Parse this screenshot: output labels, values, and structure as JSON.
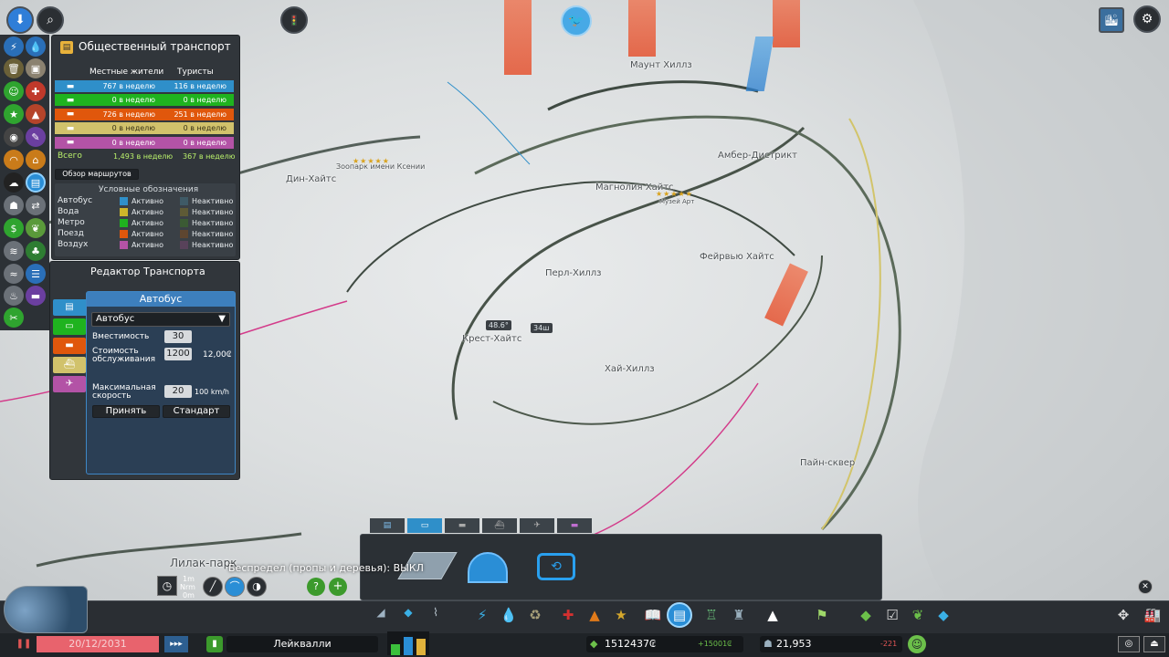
{
  "map": {
    "districts": [
      "Маунт Хиллз",
      "Дин-Хайтс",
      "Зоопарк имени Ксении",
      "Амбер-Дистрикт",
      "Магнолия Хайтс",
      "Музей Арт",
      "Перл-Хиллз",
      "Фейрвью Хайтс",
      "Крест-Хайтс",
      "Хай-Хиллз",
      "Пайн-сквер",
      "Лилак-парк"
    ],
    "tags": [
      "48.6°",
      "34ш"
    ],
    "stars_a": "★★★★★",
    "stars_b": "★★★★★"
  },
  "transport_panel": {
    "title": "Общественный транспорт",
    "col_locals": "Местные жители",
    "col_tourists": "Туристы",
    "rows": [
      {
        "icon": "bus-icon",
        "color": "#2f8fc9",
        "locals": "767 в неделю",
        "tourists": "116 в неделю"
      },
      {
        "icon": "metro-icon",
        "color": "#1fb31f",
        "locals": "0 в неделю",
        "tourists": "0 в неделю"
      },
      {
        "icon": "train-icon",
        "color": "#e0570c",
        "locals": "726 в неделю",
        "tourists": "251 в неделю"
      },
      {
        "icon": "ship-icon",
        "color": "#d1c26b",
        "locals": "0 в неделю",
        "tourists": "0 в неделю"
      },
      {
        "icon": "plane-icon",
        "color": "#b353a6",
        "locals": "0 в неделю",
        "tourists": "0 в неделю"
      }
    ],
    "total_label": "Всего",
    "total_locals": "1,493 в неделю",
    "total_tourists": "367 в неделю",
    "routes_button": "Обзор маршрутов",
    "legend_title": "Условные обозначения",
    "legend": [
      {
        "name": "Автобус",
        "active_color": "#2f8fc9",
        "inactive_color": "#3f5a66"
      },
      {
        "name": "Вода",
        "active_color": "#cdb52a",
        "inactive_color": "#5e5a36"
      },
      {
        "name": "Метро",
        "active_color": "#1fb31f",
        "inactive_color": "#3b5a34"
      },
      {
        "name": "Поезд",
        "active_color": "#e0570c",
        "inactive_color": "#5e4630"
      },
      {
        "name": "Воздух",
        "active_color": "#b353a6",
        "inactive_color": "#58425a"
      }
    ],
    "active_label": "Активно",
    "inactive_label": "Неактивно"
  },
  "editor": {
    "title": "Редактор Транспорта",
    "section": "Автобус",
    "dropdown_value": "Автобус",
    "capacity_label": "Вместимость",
    "capacity_value": "30",
    "upkeep_label": "Стоимость обслуживания",
    "upkeep_value": "1200",
    "upkeep_cost": "12,00₢",
    "speed_label": "Максимальная скорость",
    "speed_value": "20",
    "speed_unit": "100 km/h",
    "apply": "Принять",
    "default": "Стандарт"
  },
  "bottom": {
    "tooltip": "Беспредел (пропы и деревья): ВЫКЛ",
    "date": "20/12/2031",
    "city": "Лейквалли",
    "money": "1512437₢",
    "income": "+15001₢",
    "population": "21,953",
    "pop_change": "-221",
    "temp_1m": "1m",
    "temp_nrm": "Nrm",
    "temp_0m": "0m",
    "speed_label": "▸▸▸",
    "pause_label": "❚❚"
  }
}
